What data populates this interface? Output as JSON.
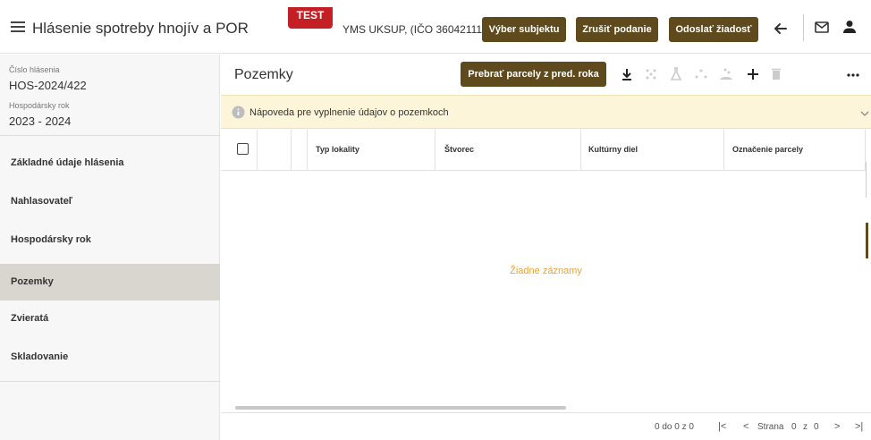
{
  "header": {
    "title": "Hlásenie spotreby hnojív a POR",
    "env_badge": "TEST",
    "subject": "YMS UKSUP, (IČO 36042111)",
    "buttons": {
      "select_subject": "Výber subjektu",
      "cancel_submission": "Zrušiť podanie",
      "send_request": "Odoslať žiadosť"
    },
    "icons": [
      "menu-icon",
      "back-arrow-icon",
      "mail-icon",
      "user-icon"
    ]
  },
  "sidebar": {
    "report_number_label": "Číslo hlásenia",
    "report_number": "HOS-2024/422",
    "fiscal_year_label": "Hospodársky rok",
    "fiscal_year": "2023 - 2024",
    "items": [
      {
        "label": "Základné údaje hlásenia",
        "active": false
      },
      {
        "label": "Nahlasovateľ",
        "active": false
      },
      {
        "label": "Hospodársky rok",
        "active": false
      },
      {
        "label": "Pozemky",
        "active": true
      },
      {
        "label": "Zvieratá",
        "active": false
      },
      {
        "label": "Skladovanie",
        "active": false
      }
    ]
  },
  "main": {
    "title": "Pozemky",
    "take_parcels_button": "Prebrať parcely z pred. roka",
    "toolbar_icons": [
      "download-icon",
      "split-icon",
      "lab-flask-icon",
      "scatter-icon",
      "fertilize-icon",
      "add-icon",
      "delete-icon",
      "more-icon"
    ],
    "help_text": "Nápoveda pre vyplnenie údajov o pozemkoch",
    "columns": [
      "Typ lokality",
      "Štvorec",
      "Kultúrny diel",
      "Označenie parcely"
    ],
    "rows": [],
    "empty_text": "Žiadne záznamy",
    "pagination": {
      "range": "0 do 0 z 0",
      "page_label": "Strana",
      "page": "0",
      "of_label": "z",
      "total": "0"
    }
  },
  "colors": {
    "primary_button": "#5e4a1c",
    "badge": "#c41f25",
    "help_bar": "#fdf5da",
    "active_nav": "#d9d6d0",
    "empty_text": "#e8a33d"
  }
}
